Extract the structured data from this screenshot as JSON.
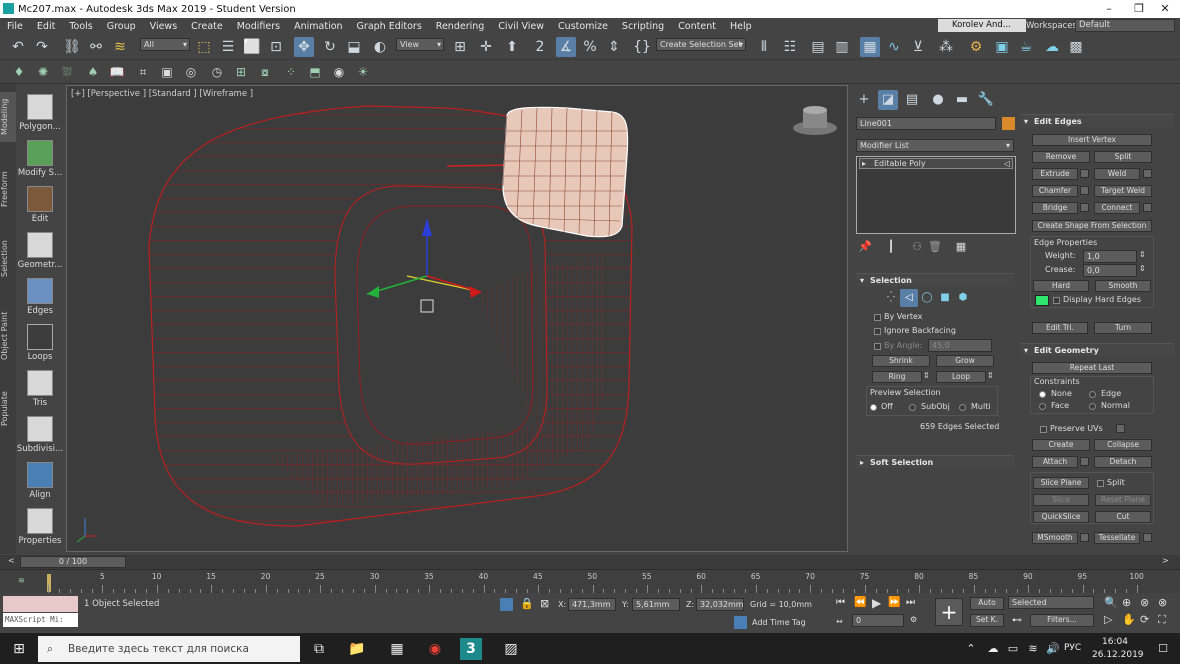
{
  "window": {
    "title": "Mc207.max - Autodesk 3ds Max 2019 - Student Version"
  },
  "menu": [
    "File",
    "Edit",
    "Tools",
    "Group",
    "Views",
    "Create",
    "Modifiers",
    "Animation",
    "Graph Editors",
    "Rendering",
    "Civil View",
    "Customize",
    "Scripting",
    "Content",
    "Help"
  ],
  "user": {
    "name": "Korolev And...",
    "workspaces_label": "Workspaces:",
    "workspace": "Default"
  },
  "toolbar": {
    "filter": "All",
    "view_dropdown": "View",
    "selection_set": "Create Selection Set"
  },
  "ribbon": {
    "tabs": [
      "Modeling",
      "Freeform",
      "Selection",
      "Object Paint",
      "Populate"
    ],
    "tools": [
      "Polygon...",
      "Modify S...",
      "Edit",
      "Geometr...",
      "Edges",
      "Loops",
      "Tris",
      "Subdivisi...",
      "Align",
      "Properties"
    ]
  },
  "viewport": {
    "label": "[+] [Perspective ] [Standard ] [Wireframe ]"
  },
  "command_panel": {
    "object_name": "Line001",
    "object_color": "#d98a2b",
    "modifier_list": "Modifier List",
    "stack_item": "Editable Poly",
    "selection": {
      "title": "Selection",
      "by_vertex": "By Vertex",
      "ignore_backfacing": "Ignore Backfacing",
      "by_angle": "By Angle:",
      "angle_value": "45,0",
      "shrink": "Shrink",
      "grow": "Grow",
      "ring": "Ring",
      "loop": "Loop",
      "preview_selection": "Preview Selection",
      "off": "Off",
      "subobj": "SubObj",
      "multi": "Multi",
      "status": "659 Edges Selected"
    },
    "soft_selection": "Soft Selection"
  },
  "edit_edges": {
    "title": "Edit Edges",
    "insert_vertex": "Insert Vertex",
    "remove": "Remove",
    "split": "Split",
    "extrude": "Extrude",
    "weld": "Weld",
    "chamfer": "Chamfer",
    "target_weld": "Target Weld",
    "bridge": "Bridge",
    "connect": "Connect",
    "create_shape": "Create Shape From Selection",
    "edge_properties": "Edge Properties",
    "weight_label": "Weight:",
    "weight": "1,0",
    "crease_label": "Crease:",
    "crease": "0,0",
    "hard": "Hard",
    "smooth": "Smooth",
    "display_hard_edges": "Display Hard Edges",
    "hard_edge_color": "#2ee66b",
    "edit_tri": "Edit Tri.",
    "turn": "Turn"
  },
  "edit_geometry": {
    "title": "Edit Geometry",
    "repeat_last": "Repeat Last",
    "constraints": "Constraints",
    "none": "None",
    "edge": "Edge",
    "face": "Face",
    "normal": "Normal",
    "preserve_uvs": "Preserve UVs",
    "create": "Create",
    "collapse": "Collapse",
    "attach": "Attach",
    "detach": "Detach",
    "slice_plane": "Slice Plane",
    "split": "Split",
    "slice": "Slice",
    "reset_plane": "Reset Plane",
    "quickslice": "QuickSlice",
    "cut": "Cut",
    "msmooth": "MSmooth",
    "tessellate": "Tessellate"
  },
  "timeline": {
    "frame": "0 / 100",
    "ticks": [
      "5",
      "10",
      "15",
      "20",
      "25",
      "30",
      "35",
      "40",
      "45",
      "50",
      "55",
      "60",
      "65",
      "70",
      "75",
      "80",
      "85",
      "90",
      "95",
      "100"
    ]
  },
  "status": {
    "maxscript": "MAXScript Mi:",
    "objects_selected": "1 Object Selected",
    "x_label": "X:",
    "x": "471,3mm",
    "y_label": "Y:",
    "y": "5,61mm",
    "z_label": "Z:",
    "z": "32,032mm",
    "grid": "Grid = 10,0mm",
    "add_time_tag": "Add Time Tag",
    "auto": "Auto",
    "set_key": "Set K.",
    "selected": "Selected",
    "filters": "Filters...",
    "frame_field": "0"
  },
  "taskbar": {
    "search_placeholder": "Введите здесь текст для поиска",
    "lang": "РУС",
    "time": "16:04",
    "date": "26.12.2019"
  }
}
